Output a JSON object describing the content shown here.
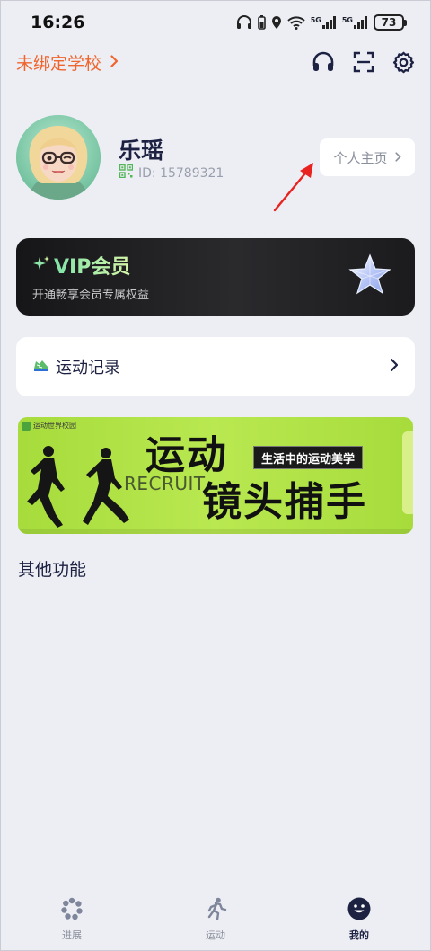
{
  "status_bar": {
    "time": "16:26",
    "battery": "73",
    "network_1": "5G",
    "network_2": "5G"
  },
  "top_bar": {
    "school_label": "未绑定学校",
    "accent_color": "#f0642d",
    "icons": [
      "headset-icon",
      "scan-icon",
      "settings-icon"
    ]
  },
  "profile": {
    "name": "乐瑶",
    "id_text": "ID: 15789321",
    "homepage_label": "个人主页"
  },
  "vip": {
    "title": "VIP会员",
    "subtitle": "开通畅享会员专属权益"
  },
  "record": {
    "label": "运动记录"
  },
  "banner": {
    "badge": "运动世界校园",
    "title_line1": "运动",
    "title_line2": "镜头捕手",
    "recruit": "RECRUIT",
    "tag": "生活中的运动美学"
  },
  "sections": {
    "other_features": "其他功能"
  },
  "bottom_nav": {
    "items": [
      {
        "label": "进展",
        "icon": "progress-icon",
        "active": false
      },
      {
        "label": "运动",
        "icon": "running-icon",
        "active": false
      },
      {
        "label": "我的",
        "icon": "smile-face-icon",
        "active": true
      }
    ]
  }
}
